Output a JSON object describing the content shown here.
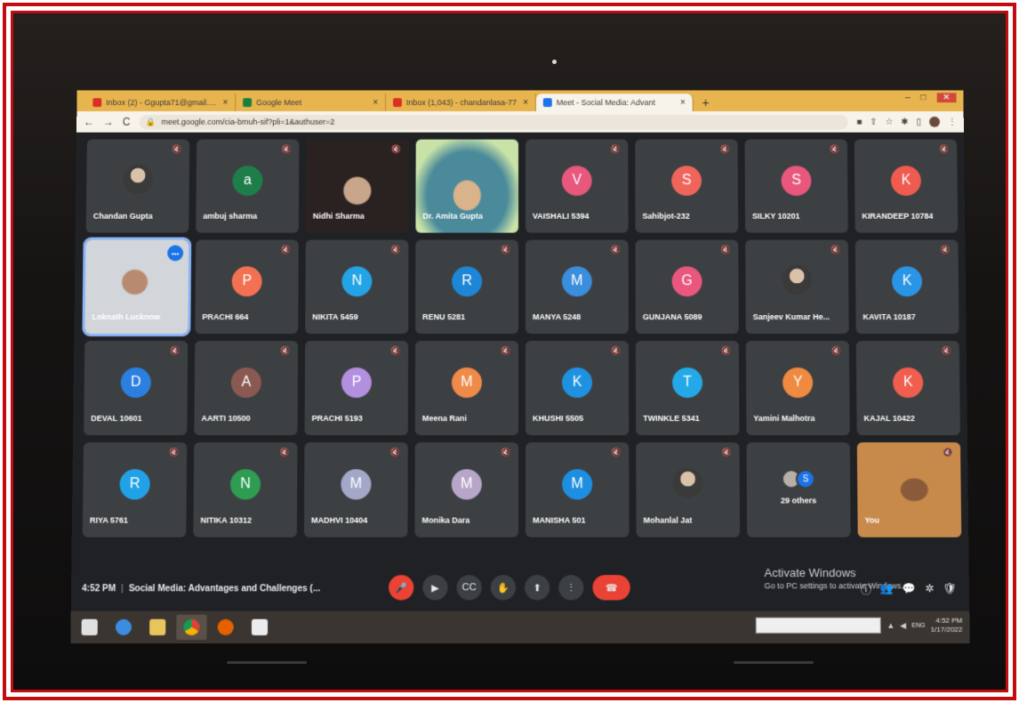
{
  "tabs": [
    {
      "title": "Inbox (2) - Ggupta71@gmail.com",
      "close": "×",
      "favicon_color": "#d93025"
    },
    {
      "title": "Google Meet",
      "close": "×",
      "favicon_color": "#188038"
    },
    {
      "title": "Inbox (1,043) - chandanlasa-77",
      "close": "×",
      "favicon_color": "#d93025"
    },
    {
      "title": "Meet - Social Media: Advant",
      "close": "×",
      "favicon_color": "#1a73e8"
    }
  ],
  "new_tab": "+",
  "window_controls": {
    "minimize": "–",
    "maximize": "□",
    "close": "✕"
  },
  "address_bar": {
    "url": "meet.google.com/cia-bmuh-sif?pli=1&authuser=2",
    "back": "←",
    "forward": "→",
    "reload": "C"
  },
  "participants": [
    {
      "name": "Chandan Gupta",
      "kind": "photo"
    },
    {
      "name": "ambuj sharma",
      "kind": "letter",
      "initial": "a",
      "color": "#1e7e4a"
    },
    {
      "name": "Nidhi Sharma",
      "kind": "video"
    },
    {
      "name": "Dr. Amita Gupta",
      "kind": "video2"
    },
    {
      "name": "VAISHALI 5394",
      "kind": "letter",
      "initial": "V",
      "color": "#e8577c"
    },
    {
      "name": "Sahibjot-232",
      "kind": "letter",
      "initial": "S",
      "color": "#f0655b"
    },
    {
      "name": "SILKY 10201",
      "kind": "letter",
      "initial": "S",
      "color": "#e8577c"
    },
    {
      "name": "KIRANDEEP 10784",
      "kind": "letter",
      "initial": "K",
      "color": "#ef5b4f"
    },
    {
      "name": "Loknath Lucknow",
      "kind": "speaker"
    },
    {
      "name": "PRACHI 664",
      "kind": "letter",
      "initial": "P",
      "color": "#f37152"
    },
    {
      "name": "NIKITA 5459",
      "kind": "letter",
      "initial": "N",
      "color": "#24a4e6"
    },
    {
      "name": "RENU 5281",
      "kind": "letter",
      "initial": "R",
      "color": "#1e86d6"
    },
    {
      "name": "MANYA 5248",
      "kind": "letter",
      "initial": "M",
      "color": "#3b8ddd"
    },
    {
      "name": "GUNJANA 5089",
      "kind": "letter",
      "initial": "G",
      "color": "#e9577e"
    },
    {
      "name": "Sanjeev Kumar He...",
      "kind": "photo"
    },
    {
      "name": "KAVITA 10187",
      "kind": "letter",
      "initial": "K",
      "color": "#2a95e6"
    },
    {
      "name": "DEVAL 10601",
      "kind": "letter",
      "initial": "D",
      "color": "#2b7fe0"
    },
    {
      "name": "AARTI 10500",
      "kind": "letter",
      "initial": "A",
      "color": "#8a5a52"
    },
    {
      "name": "PRACHI 5193",
      "kind": "letter",
      "initial": "P",
      "color": "#b38fe0"
    },
    {
      "name": "Meena Rani",
      "kind": "letter",
      "initial": "M",
      "color": "#ef8a4a"
    },
    {
      "name": "KHUSHI 5505",
      "kind": "letter",
      "initial": "K",
      "color": "#1e92e0"
    },
    {
      "name": "TWINKLE 5341",
      "kind": "letter",
      "initial": "T",
      "color": "#24a9e8"
    },
    {
      "name": "Yamini Malhotra",
      "kind": "letter",
      "initial": "Y",
      "color": "#f08a40"
    },
    {
      "name": "KAJAL 10422",
      "kind": "letter",
      "initial": "K",
      "color": "#ef5e4e"
    },
    {
      "name": "RIYA 5761",
      "kind": "letter",
      "initial": "R",
      "color": "#22a2e6"
    },
    {
      "name": "NITIKA 10312",
      "kind": "letter",
      "initial": "N",
      "color": "#2e9d52"
    },
    {
      "name": "MADHVI 10404",
      "kind": "letter",
      "initial": "M",
      "color": "#a4a8c8"
    },
    {
      "name": "Monika Dara",
      "kind": "letter",
      "initial": "M",
      "color": "#b8a6c8"
    },
    {
      "name": "MANISHA 501",
      "kind": "letter",
      "initial": "M",
      "color": "#1e8fe0"
    },
    {
      "name": "Mohanlal Jat",
      "kind": "photo"
    },
    {
      "name": "29 others",
      "kind": "others",
      "initial": "S",
      "color": "#1a73e8"
    },
    {
      "name": "You",
      "kind": "self"
    }
  ],
  "meeting": {
    "time": "4:52 PM",
    "separator": "|",
    "title": "Social Media: Advantages and Challenges (..."
  },
  "controls": [
    "mic-off",
    "camera",
    "captions",
    "raise-hand",
    "present",
    "more",
    "hang-up"
  ],
  "watermark": {
    "line1": "Activate Windows",
    "line2": "Go to PC settings to activate Windows."
  },
  "tray": {
    "time": "4:52 PM",
    "date": "1/17/2022",
    "lang": "ENG"
  }
}
